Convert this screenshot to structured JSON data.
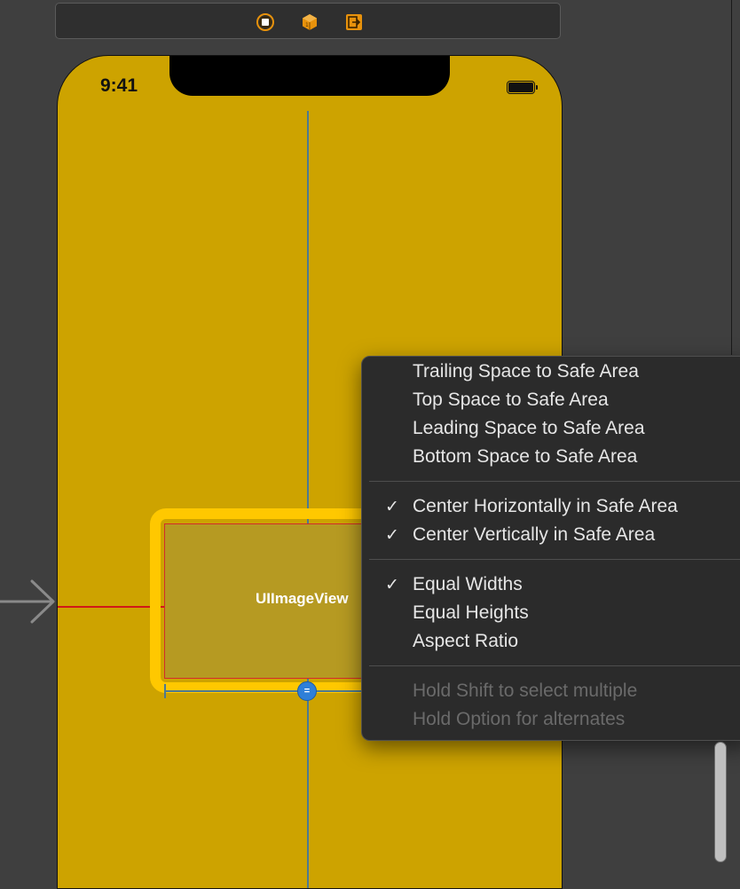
{
  "scene_bar": {
    "icons": [
      "view-controller-icon",
      "first-responder-icon",
      "exit-icon"
    ],
    "accent_color": "#e8920c"
  },
  "device": {
    "status_bar": {
      "time": "9:41"
    },
    "background_color": "#cda300"
  },
  "image_view": {
    "label": "UIImageView"
  },
  "context_menu": {
    "groups": [
      [
        {
          "label": "Trailing Space to Safe Area",
          "checked": false
        },
        {
          "label": "Top Space to Safe Area",
          "checked": false
        },
        {
          "label": "Leading Space to Safe Area",
          "checked": false
        },
        {
          "label": "Bottom Space to Safe Area",
          "checked": false
        }
      ],
      [
        {
          "label": "Center Horizontally in Safe Area",
          "checked": true
        },
        {
          "label": "Center Vertically in Safe Area",
          "checked": true
        }
      ],
      [
        {
          "label": "Equal Widths",
          "checked": true
        },
        {
          "label": "Equal Heights",
          "checked": false
        },
        {
          "label": "Aspect Ratio",
          "checked": false
        }
      ],
      [
        {
          "label": "Hold Shift to select multiple",
          "checked": false,
          "disabled": true
        },
        {
          "label": "Hold Option for alternates",
          "checked": false,
          "disabled": true
        }
      ]
    ],
    "check_glyph": "✓"
  }
}
